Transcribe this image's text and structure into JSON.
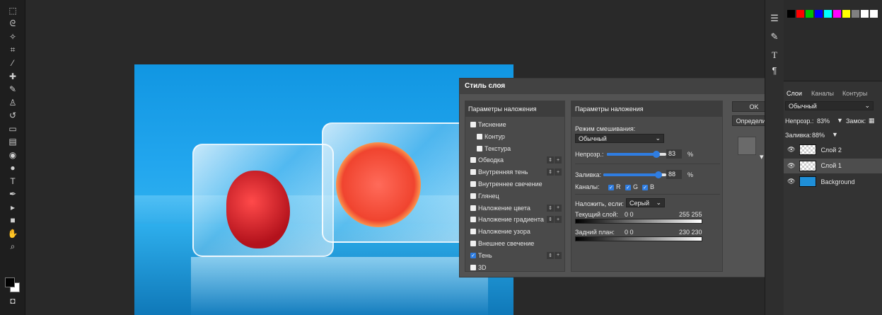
{
  "toolbar": {
    "icons": [
      "marquee-icon",
      "lasso-icon",
      "magic-wand-icon",
      "crop-icon",
      "eyedropper-icon",
      "healing-icon",
      "brush-icon",
      "stamp-icon",
      "history-brush-icon",
      "eraser-icon",
      "gradient-icon",
      "blur-icon",
      "dodge-icon",
      "type-icon",
      "pen-icon",
      "path-select-icon",
      "shape-icon",
      "hand-icon",
      "zoom-icon"
    ]
  },
  "dialog": {
    "title": "Стиль слоя",
    "close": "×",
    "fx_header": "Параметры наложения",
    "fx": [
      {
        "label": "Тиснение",
        "checked": false,
        "indent": false,
        "plus": false
      },
      {
        "label": "Контур",
        "checked": false,
        "indent": true,
        "plus": false
      },
      {
        "label": "Текстура",
        "checked": false,
        "indent": true,
        "plus": false
      },
      {
        "label": "Обводка",
        "checked": false,
        "indent": false,
        "plus": true
      },
      {
        "label": "Внутренняя тень",
        "checked": false,
        "indent": false,
        "plus": true
      },
      {
        "label": "Внутреннее свечение",
        "checked": false,
        "indent": false,
        "plus": false
      },
      {
        "label": "Глянец",
        "checked": false,
        "indent": false,
        "plus": false
      },
      {
        "label": "Наложение цвета",
        "checked": false,
        "indent": false,
        "plus": true
      },
      {
        "label": "Наложение градиента",
        "checked": false,
        "indent": false,
        "plus": true
      },
      {
        "label": "Наложение узора",
        "checked": false,
        "indent": false,
        "plus": false
      },
      {
        "label": "Внешнее свечение",
        "checked": false,
        "indent": false,
        "plus": false
      },
      {
        "label": "Тень",
        "checked": true,
        "indent": false,
        "plus": true
      },
      {
        "label": "3D",
        "checked": false,
        "indent": false,
        "plus": false
      }
    ],
    "settings": {
      "header": "Параметры наложения",
      "blend_mode_label": "Режим смешивания:",
      "blend_mode_value": "Обычный",
      "opacity_label": "Непрозр.:",
      "opacity_value": "83",
      "percent": "%",
      "fill_label": "Заливка:",
      "fill_value": "88",
      "channels_label": "Каналы:",
      "ch_r": "R",
      "ch_g": "G",
      "ch_b": "B",
      "blendif_label": "Наложить, если:",
      "blendif_value": "Серый",
      "current_label": "Текущий слой:",
      "current_lo": "0   0",
      "current_hi": "255 255",
      "under_label": "Задний план:",
      "under_lo": "0   0",
      "under_hi": "230 230",
      "opacity_fraction": 0.83,
      "fill_fraction": 0.88
    },
    "ok": "OK",
    "define": "Определить",
    "preview_arrow": "▾"
  },
  "right_strip": {
    "icons": [
      "properties-icon",
      "brush-settings-icon",
      "character-icon",
      "paragraph-icon"
    ]
  },
  "colors": {
    "swatches": [
      "#000000",
      "#ff0000",
      "#00c000",
      "#0000ff",
      "#00ffff",
      "#ff00ff",
      "#ffff00",
      "#808080",
      "#ffffff",
      "#ffffff"
    ]
  },
  "layers": {
    "tabs": [
      "Слои",
      "Каналы",
      "Контуры"
    ],
    "blend": "Обычный",
    "opacity_label": "Непрозр.:",
    "opacity_value": "83%",
    "lock_label": "Замок:",
    "fill_label": "Заливка:",
    "fill_value": "88%",
    "items": [
      {
        "name": "Слой 2",
        "selected": false
      },
      {
        "name": "Слой 1",
        "selected": true
      },
      {
        "name": "Background",
        "selected": false
      }
    ]
  }
}
